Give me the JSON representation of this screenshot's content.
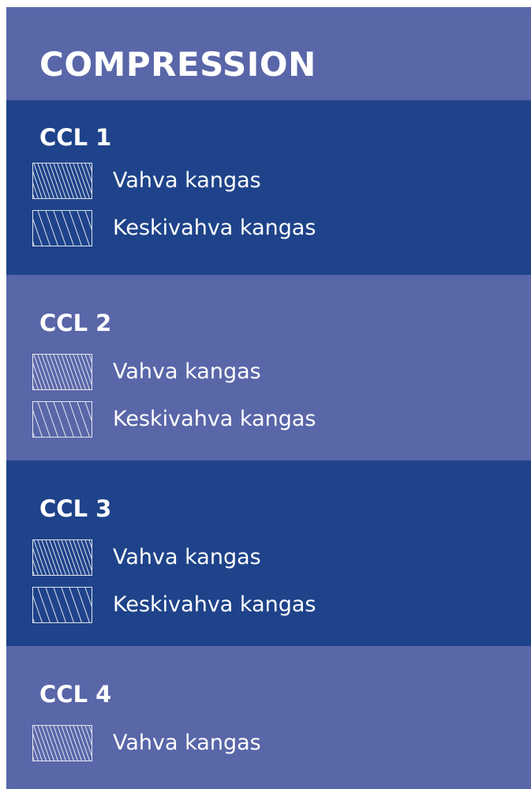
{
  "title": "COMPRESSION",
  "colors": {
    "dark_band": "#1f438a",
    "light_band": "#5966a8",
    "text": "#ffffff"
  },
  "sections": [
    {
      "title": "CCL 1",
      "items": [
        {
          "label": "Vahva kangas",
          "pattern": "dense-hatch-icon"
        },
        {
          "label": "Keskivahva kangas",
          "pattern": "sparse-hatch-icon"
        }
      ]
    },
    {
      "title": "CCL 2",
      "items": [
        {
          "label": "Vahva kangas",
          "pattern": "dense-hatch-icon"
        },
        {
          "label": "Keskivahva kangas",
          "pattern": "sparse-hatch-icon"
        }
      ]
    },
    {
      "title": "CCL 3",
      "items": [
        {
          "label": "Vahva kangas",
          "pattern": "dense-hatch-icon"
        },
        {
          "label": "Keskivahva kangas",
          "pattern": "sparse-hatch-icon"
        }
      ]
    },
    {
      "title": "CCL 4",
      "items": [
        {
          "label": "Vahva kangas",
          "pattern": "dense-hatch-icon"
        }
      ]
    }
  ]
}
